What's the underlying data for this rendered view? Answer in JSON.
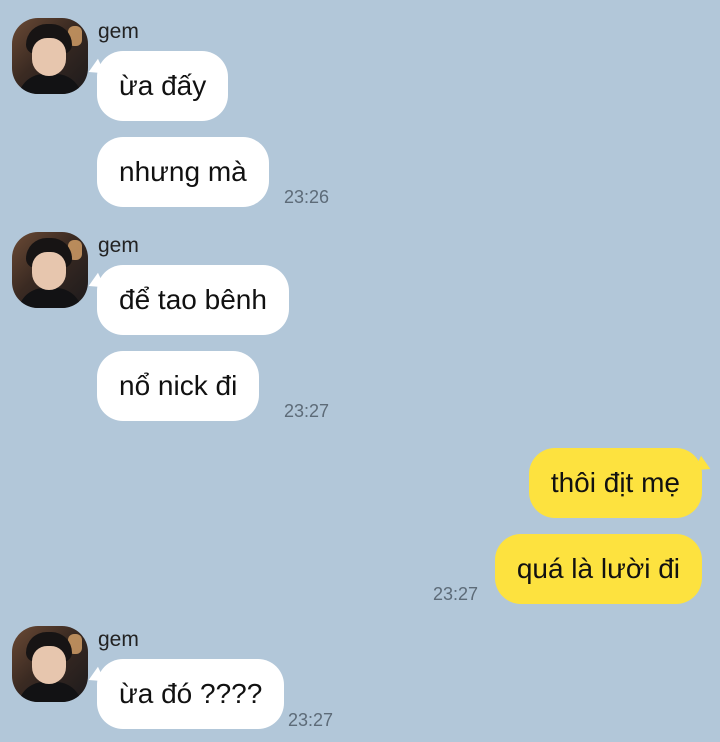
{
  "chat": {
    "groups": [
      {
        "sender": "gem",
        "avatar_icon": "profile-photo",
        "messages": [
          "ừa đấy",
          "nhưng mà"
        ],
        "time": "23:26"
      },
      {
        "sender": "gem",
        "avatar_icon": "profile-photo",
        "messages": [
          "để tao bênh",
          "nổ nick đi"
        ],
        "time": "23:27"
      },
      {
        "sender": "me",
        "messages": [
          "thôi địt mẹ",
          "quá là lười đi"
        ],
        "time": "23:27"
      },
      {
        "sender": "gem",
        "avatar_icon": "profile-photo",
        "messages": [
          "ừa đó ????"
        ],
        "time": "23:27"
      }
    ]
  },
  "colors": {
    "background": "#b2c7d9",
    "incoming_bubble": "#ffffff",
    "outgoing_bubble": "#fde23f",
    "timestamp": "#5d6b78"
  }
}
